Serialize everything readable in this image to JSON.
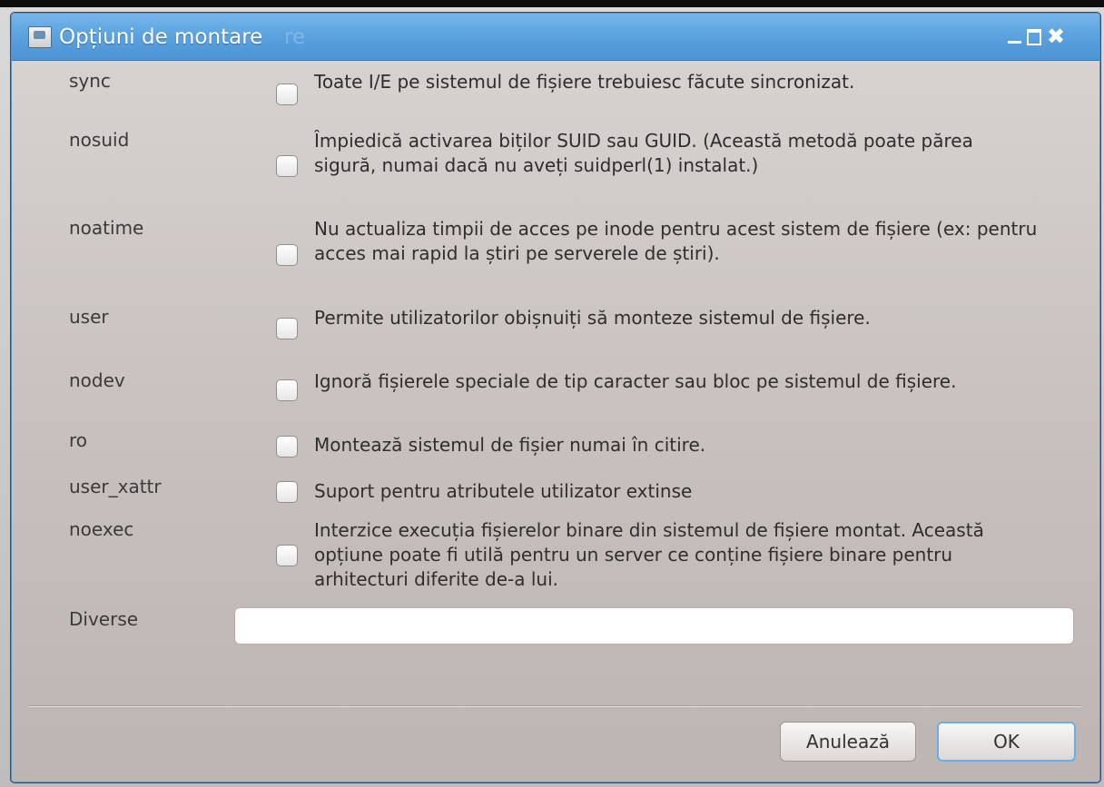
{
  "window": {
    "title": "Opțiuni de montare",
    "title_ghost_text": "re"
  },
  "options": [
    {
      "name": "sync",
      "checked": false,
      "description": "Toate I/E pe sistemul de fișiere trebuiesc făcute sincronizat."
    },
    {
      "name": "nosuid",
      "checked": false,
      "description": "Împiedică activarea biților SUID sau GUID. (Această metodă poate părea sigură, numai dacă nu aveți suidperl(1) instalat.)"
    },
    {
      "name": "noatime",
      "checked": false,
      "description": "Nu actualiza timpii de acces pe inode pentru acest sistem de fișiere (ex: pentru acces mai rapid la știri pe serverele de știri)."
    },
    {
      "name": "user",
      "checked": false,
      "description": "Permite utilizatorilor obișnuiți să monteze sistemul de fișiere."
    },
    {
      "name": "nodev",
      "checked": false,
      "description": "Ignoră fișierele speciale de tip caracter sau bloc pe sistemul de fișiere."
    },
    {
      "name": "ro",
      "checked": false,
      "description": "Montează sistemul de fișier numai în citire."
    },
    {
      "name": "user_xattr",
      "checked": false,
      "description": "Suport pentru atributele utilizator extinse"
    },
    {
      "name": "noexec",
      "checked": false,
      "description": "Interzice execuția fișierelor binare din sistemul de fișiere montat. Această opțiune poate fi utilă pentru un server ce conține fișiere binare pentru arhitecturi diferite de-a lui."
    }
  ],
  "diverse": {
    "label": "Diverse",
    "value": ""
  },
  "buttons": {
    "cancel": "Anulează",
    "ok": "OK"
  }
}
